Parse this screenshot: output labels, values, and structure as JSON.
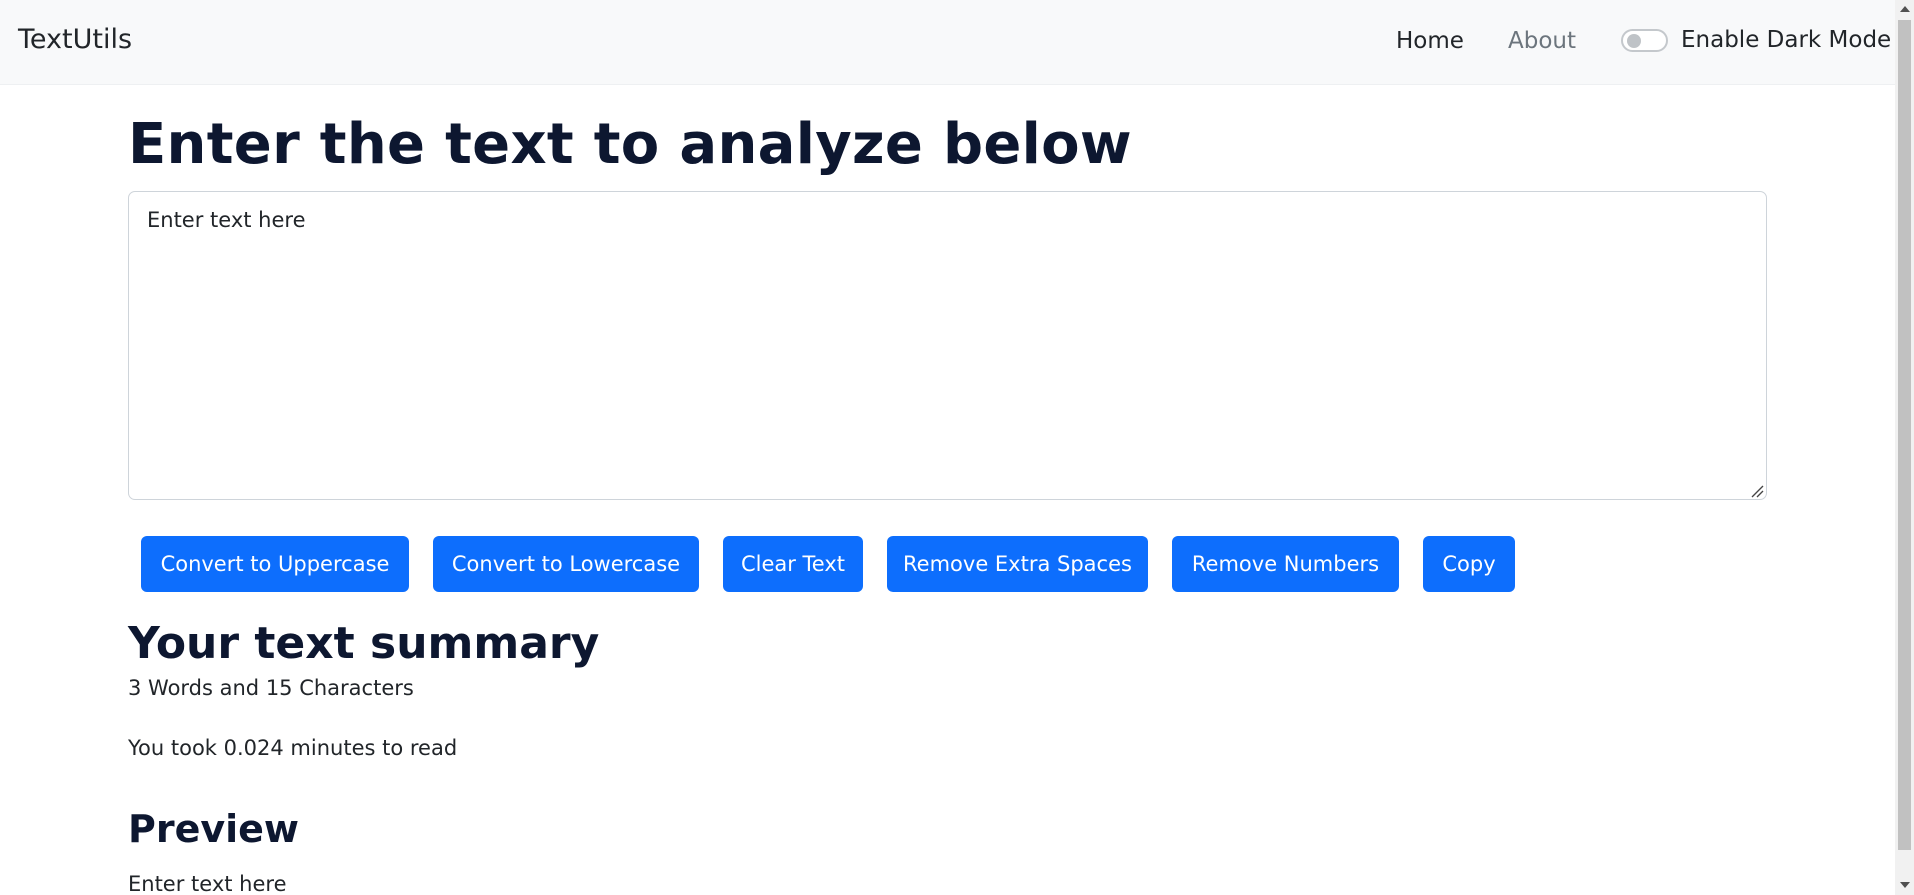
{
  "navbar": {
    "brand": "TextUtils",
    "links": {
      "home": "Home",
      "about": "About"
    },
    "dark_mode_label": "Enable Dark Mode",
    "dark_mode_enabled": false
  },
  "main": {
    "heading": "Enter the text to analyze below",
    "textarea_value": "Enter text here",
    "buttons": {
      "uppercase": "Convert to Uppercase",
      "lowercase": "Convert to Lowercase",
      "clear": "Clear Text",
      "remove_spaces": "Remove Extra Spaces",
      "remove_numbers": "Remove Numbers",
      "copy": "Copy"
    }
  },
  "summary": {
    "heading": "Your text summary",
    "counts": "3 Words and 15 Characters",
    "read_time": "You took 0.024 minutes to read"
  },
  "preview": {
    "heading": "Preview",
    "text": "Enter text here"
  },
  "colors": {
    "primary": "#0d6efd",
    "navbar_bg": "#f8f9fa",
    "heading": "#0d1730",
    "muted": "#6c757d"
  }
}
